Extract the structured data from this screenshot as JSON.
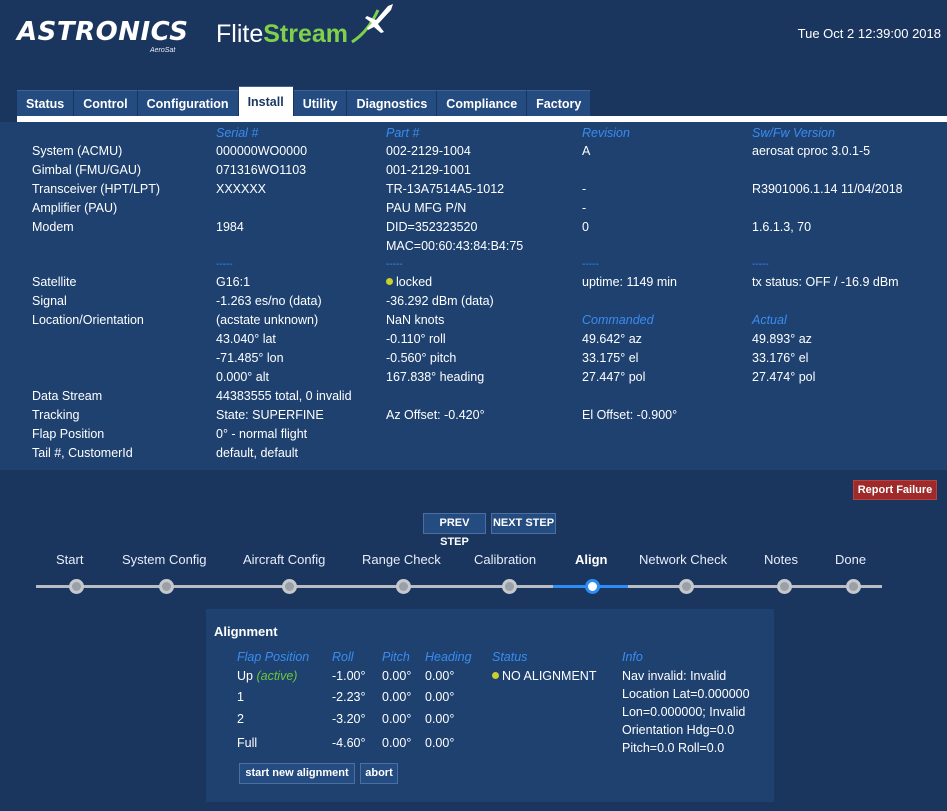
{
  "header": {
    "logo_company": "ASTRONICS",
    "logo_sub": "AeroSat",
    "logo_product_a": "Flite",
    "logo_product_b": "Stream",
    "datetime": "Tue Oct 2 12:39:00 2018"
  },
  "tabs": [
    "Status",
    "Control",
    "Configuration",
    "Install",
    "Utility",
    "Diagnostics",
    "Compliance",
    "Factory"
  ],
  "active_tab": "Install",
  "info": {
    "columns": [
      "Serial #",
      "Part #",
      "Revision",
      "Sw/Fw Version"
    ],
    "rows": [
      {
        "label": "System (ACMU)",
        "serial": "000000WO0000",
        "part": "002-2129-1004",
        "revision": "A",
        "version": "aerosat cproc 3.0.1-5"
      },
      {
        "label": "Gimbal (FMU/GAU)",
        "serial": "071316WO1103",
        "part": "001-2129-1001",
        "revision": "",
        "version": ""
      },
      {
        "label": "Transceiver (HPT/LPT)",
        "serial": "XXXXXX",
        "part": "TR-13A7514A5-1012",
        "revision": "-",
        "version": "R3901006.1.14 11/04/2018"
      },
      {
        "label": "Amplifier (PAU)",
        "serial": "",
        "part": "PAU MFG P/N",
        "revision": "-",
        "version": ""
      },
      {
        "label": "Modem",
        "serial": "1984",
        "part": "DID=352323520",
        "part2": "MAC=00:60:43:84:B4:75",
        "revision": "0",
        "version": "1.6.1.3, 70"
      }
    ],
    "separator": "-----",
    "satellite": {
      "label": "Satellite",
      "value": "G16:1",
      "lock": "locked",
      "uptime": "uptime: 1149 min",
      "tx": "tx status: OFF / -16.9 dBm"
    },
    "signal": {
      "label": "Signal",
      "esno": "-1.263 es/no (data)",
      "dbm": "-36.292 dBm (data)"
    },
    "location": {
      "label": "Location/Orientation",
      "c1": [
        "(acstate unknown)",
        "43.040° lat",
        "-71.485° lon",
        "0.000° alt"
      ],
      "c2": [
        "NaN knots",
        "-0.110° roll",
        "-0.560° pitch",
        "167.838° heading"
      ],
      "commanded_header": "Commanded",
      "actual_header": "Actual",
      "c3": [
        "49.642° az",
        "33.175° el",
        "27.447° pol"
      ],
      "c4": [
        "49.893° az",
        "33.176° el",
        "27.474° pol"
      ]
    },
    "data_stream": {
      "label": "Data Stream",
      "value": "44383555 total, 0 invalid"
    },
    "tracking": {
      "label": "Tracking",
      "state": "State: SUPERFINE",
      "az_offset": "Az Offset: -0.420°",
      "el_offset": "El Offset: -0.900°"
    },
    "flap": {
      "label": "Flap Position",
      "value": "0° - normal flight"
    },
    "tail": {
      "label": "Tail #, CustomerId",
      "value": "default, default"
    }
  },
  "wizard": {
    "report_failure": "Report Failure",
    "prev": "PREV STEP",
    "next": "NEXT STEP",
    "steps": [
      "Start",
      "System Config",
      "Aircraft Config",
      "Range Check",
      "Calibration",
      "Align",
      "Network Check",
      "Notes",
      "Done"
    ],
    "current_step": "Align"
  },
  "alignment": {
    "title": "Alignment",
    "headers": [
      "Flap Position",
      "Roll",
      "Pitch",
      "Heading",
      "Status",
      "Info"
    ],
    "rows": [
      {
        "flap": "Up",
        "tag": "(active)",
        "roll": "-1.00°",
        "pitch": "0.00°",
        "heading": "0.00°"
      },
      {
        "flap": "1",
        "roll": "-2.23°",
        "pitch": "0.00°",
        "heading": "0.00°"
      },
      {
        "flap": "2",
        "roll": "-3.20°",
        "pitch": "0.00°",
        "heading": "0.00°"
      },
      {
        "flap": "Full",
        "roll": "-4.60°",
        "pitch": "0.00°",
        "heading": "0.00°"
      }
    ],
    "status": "NO ALIGNMENT",
    "info": [
      "Nav invalid: Invalid",
      "Location Lat=0.000000",
      "Lon=0.000000; Invalid",
      "Orientation Hdg=0.0",
      "Pitch=0.0 Roll=0.0"
    ],
    "start_btn": "start new alignment",
    "abort_btn": "abort"
  }
}
